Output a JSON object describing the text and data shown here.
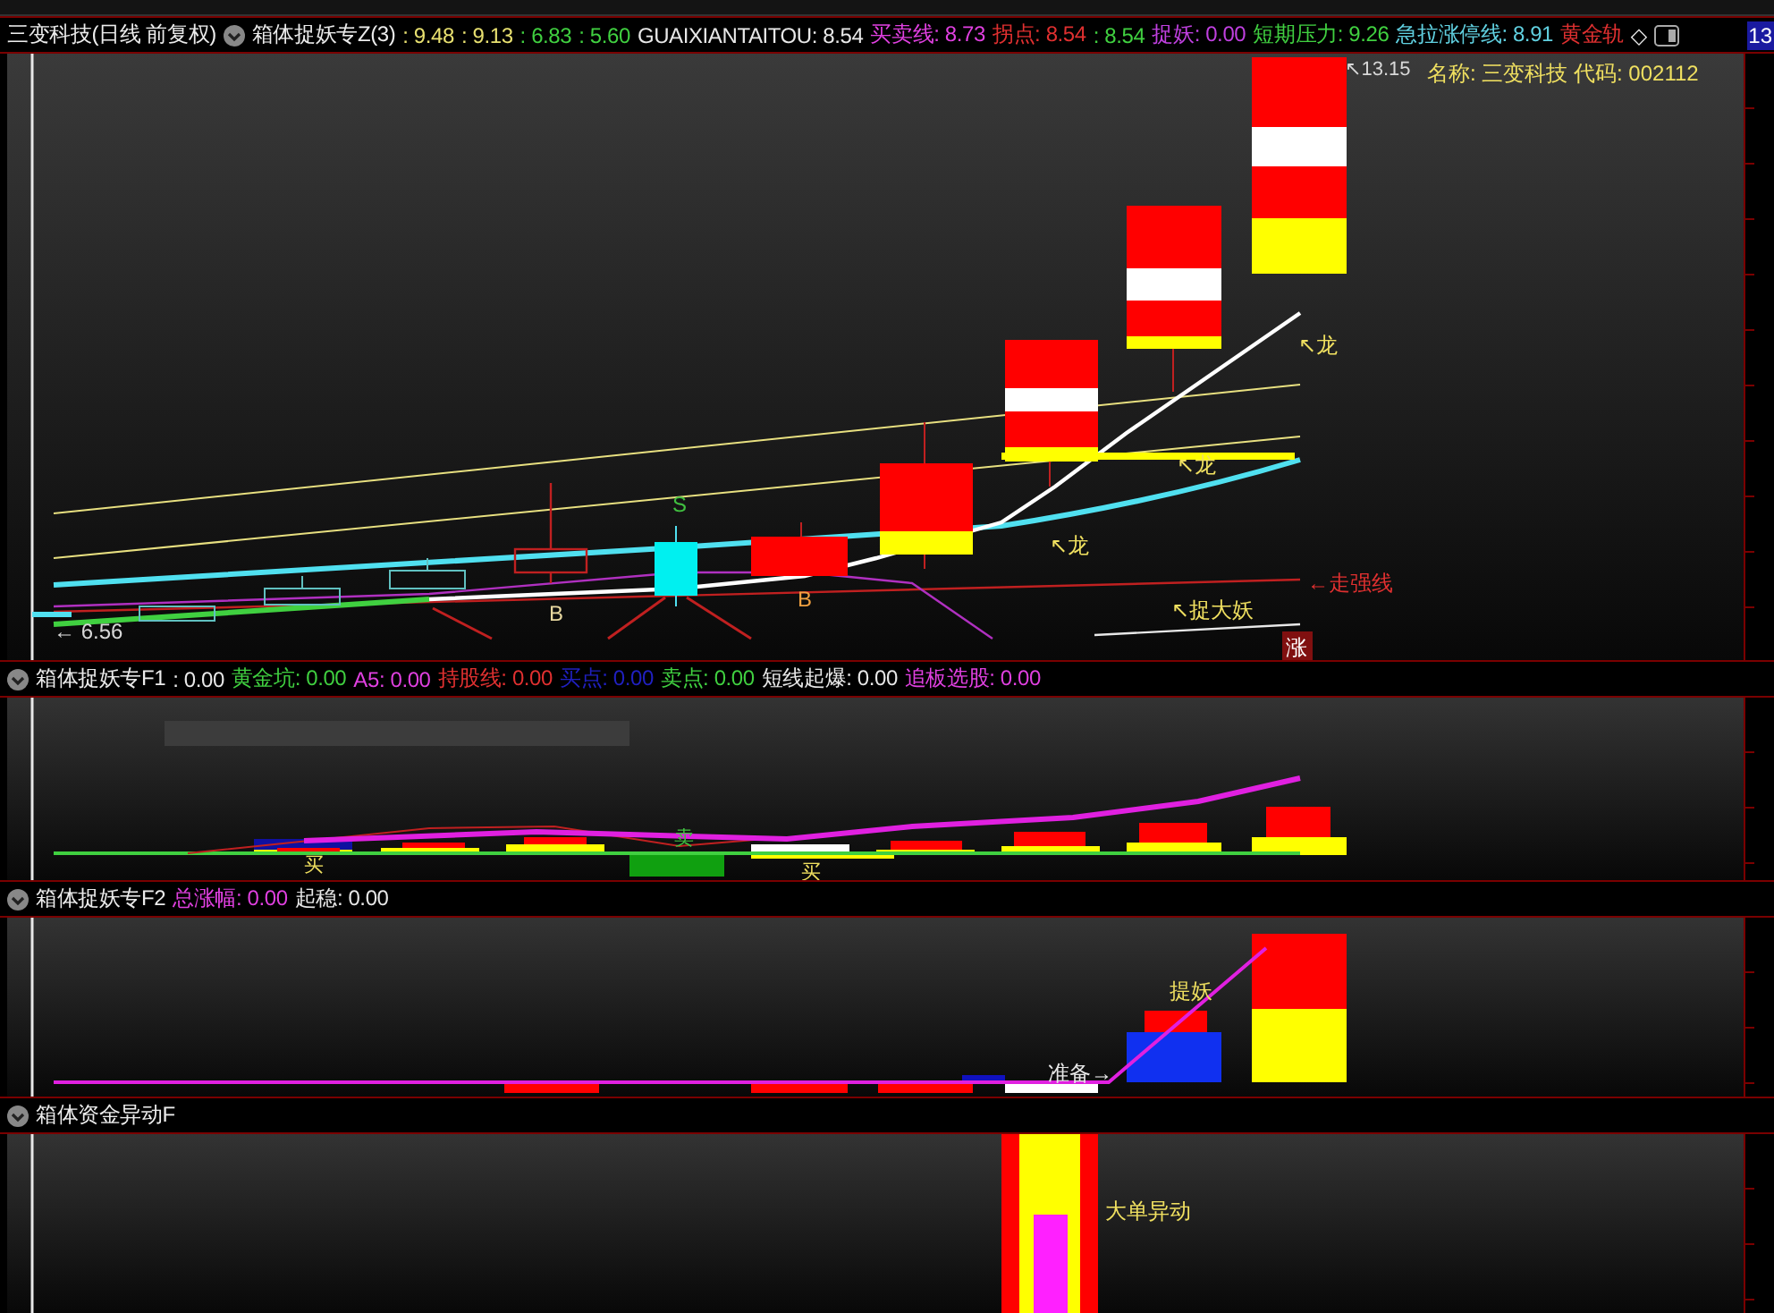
{
  "main_panel": {
    "header": {
      "title": "三变科技(日线 前复权)",
      "indicator": "箱体捉妖专Z(3)",
      "items": [
        {
          "text": ": 9.48",
          "color": "#e8e070"
        },
        {
          "text": ": 9.13",
          "color": "#e8e070"
        },
        {
          "text": ": 6.83",
          "color": "#40d040"
        },
        {
          "text": ": 5.60",
          "color": "#40d040"
        },
        {
          "text": "GUAIXIANTAITOU: 8.54",
          "color": "#e8e8e8"
        },
        {
          "text": "买卖线: 8.73",
          "color": "#e040e0"
        },
        {
          "text": "拐点: 8.54",
          "color": "#e03030"
        },
        {
          "text": ": 8.54",
          "color": "#40d040"
        },
        {
          "text": "捉妖: 0.00",
          "color": "#c040e0"
        },
        {
          "text": "短期压力: 9.26",
          "color": "#40d040"
        },
        {
          "text": "急拉涨停线: 8.91",
          "color": "#60d0e0"
        },
        {
          "text": "黄金轨",
          "color": "#e03030"
        }
      ],
      "trailing_mark": "◇",
      "axis_label": "13"
    },
    "labels": [
      {
        "text": "↖13.15",
        "color": "#d8d8d8"
      },
      {
        "text": "名称: 三变科技 代码: 002112",
        "color": "#f0e060"
      },
      {
        "text": "↖龙",
        "color": "#f0e060"
      },
      {
        "text": "↖龙",
        "color": "#f0e060"
      },
      {
        "text": "S",
        "color": "#40c040"
      },
      {
        "text": "↖龙",
        "color": "#f0e060"
      },
      {
        "text": "↖捉大妖",
        "color": "#f0e060"
      },
      {
        "text": "←走强线",
        "color": "#e03030"
      },
      {
        "text": "B",
        "color": "#e8d8a0"
      },
      {
        "text": "B",
        "color": "#f0a040"
      },
      {
        "text": "← 6.56",
        "color": "#d8d8d8"
      }
    ],
    "limit_up_badge": "涨"
  },
  "sub_panels": [
    {
      "title": "箱体捉妖专F1",
      "items": [
        {
          "text": ": 0.00",
          "color": "#e8e8e8"
        },
        {
          "text": "黄金坑: 0.00",
          "color": "#40d040"
        },
        {
          "text": "A5: 0.00",
          "color": "#e040e0"
        },
        {
          "text": "持股线: 0.00",
          "color": "#e03030"
        },
        {
          "text": "买点: 0.00",
          "color": "#2020c0"
        },
        {
          "text": "卖点: 0.00",
          "color": "#40d040"
        },
        {
          "text": "短线起爆: 0.00",
          "color": "#e8e8e8"
        },
        {
          "text": "追板选股: 0.00",
          "color": "#e040e0"
        }
      ],
      "labels": [
        {
          "text": "买",
          "color": "#f0e060"
        },
        {
          "text": "卖",
          "color": "#40c040"
        },
        {
          "text": "买",
          "color": "#f0e060"
        }
      ]
    },
    {
      "title": "箱体捉妖专F2",
      "items": [
        {
          "text": "总涨幅: 0.00",
          "color": "#e040e0"
        },
        {
          "text": "起稳: 0.00",
          "color": "#e8e8e8"
        }
      ],
      "labels": [
        {
          "text": "提妖",
          "color": "#f0e060"
        },
        {
          "text": "准备→",
          "color": "#e8e8e8"
        }
      ]
    },
    {
      "title": "箱体资金异动F",
      "labels": [
        {
          "text": "大单异动",
          "color": "#f0e060"
        }
      ]
    }
  ]
}
